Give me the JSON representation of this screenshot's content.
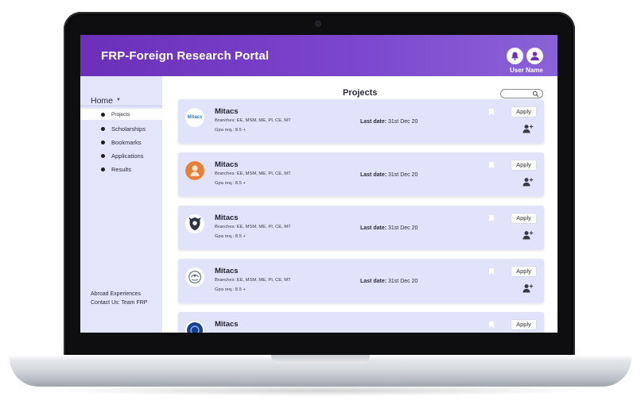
{
  "app": {
    "title": "FRP-Foreign Research Portal",
    "user_name": "User Name",
    "icons": {
      "notifications": "bell-icon",
      "profile": "user-icon"
    },
    "colors": {
      "header_start": "#6b2fb8",
      "header_end": "#8a63d8",
      "sidebar_bg": "#e3e5fb",
      "card_bg": "#e1e3fa"
    }
  },
  "sidebar": {
    "home_label": "Home",
    "items": [
      {
        "label": "Projects",
        "active": true
      },
      {
        "label": "Scholarships",
        "active": false
      },
      {
        "label": "Bookmarks",
        "active": false
      },
      {
        "label": "Applications",
        "active": false
      },
      {
        "label": "Results",
        "active": false
      }
    ],
    "footer": {
      "abroad": "Abroad Experiences",
      "contact": "Contact Us: Team FRP"
    }
  },
  "main": {
    "title": "Projects",
    "search_icon": "search-icon",
    "projects": [
      {
        "title": "Mitacs",
        "logo": "Mitacs",
        "branches": "Branches: EE, MSM, ME, PI, CE, MT",
        "gpa": "Gpa req.: 8.5 +",
        "date_label": "Last date:",
        "date_value": "31st Dec 20",
        "apply_label": "Apply"
      },
      {
        "title": "Mitacs",
        "logo": "",
        "branches": "Branches: EE, MSM, ME, PI, CE, MT",
        "gpa": "Gpa req.: 8.5 +",
        "date_label": "Last date:",
        "date_value": "31st Dec 20",
        "apply_label": "Apply"
      },
      {
        "title": "Mitacs",
        "logo": "",
        "branches": "Branches: EE, MSM, ME, PI, CE, MT",
        "gpa": "Gpa req.: 8.5 +",
        "date_label": "Last date:",
        "date_value": "31st Dec 20",
        "apply_label": "Apply"
      },
      {
        "title": "Mitacs",
        "logo": "",
        "branches": "Branches: EE, MSM, ME, PI, CE, MT",
        "gpa": "Gpa req.: 8.5 +",
        "date_label": "Last date:",
        "date_value": "31st Dec 20",
        "apply_label": "Apply"
      },
      {
        "title": "Mitacs",
        "logo": "",
        "branches": "",
        "gpa": "",
        "date_label": "",
        "date_value": "",
        "apply_label": "Apply"
      }
    ]
  }
}
